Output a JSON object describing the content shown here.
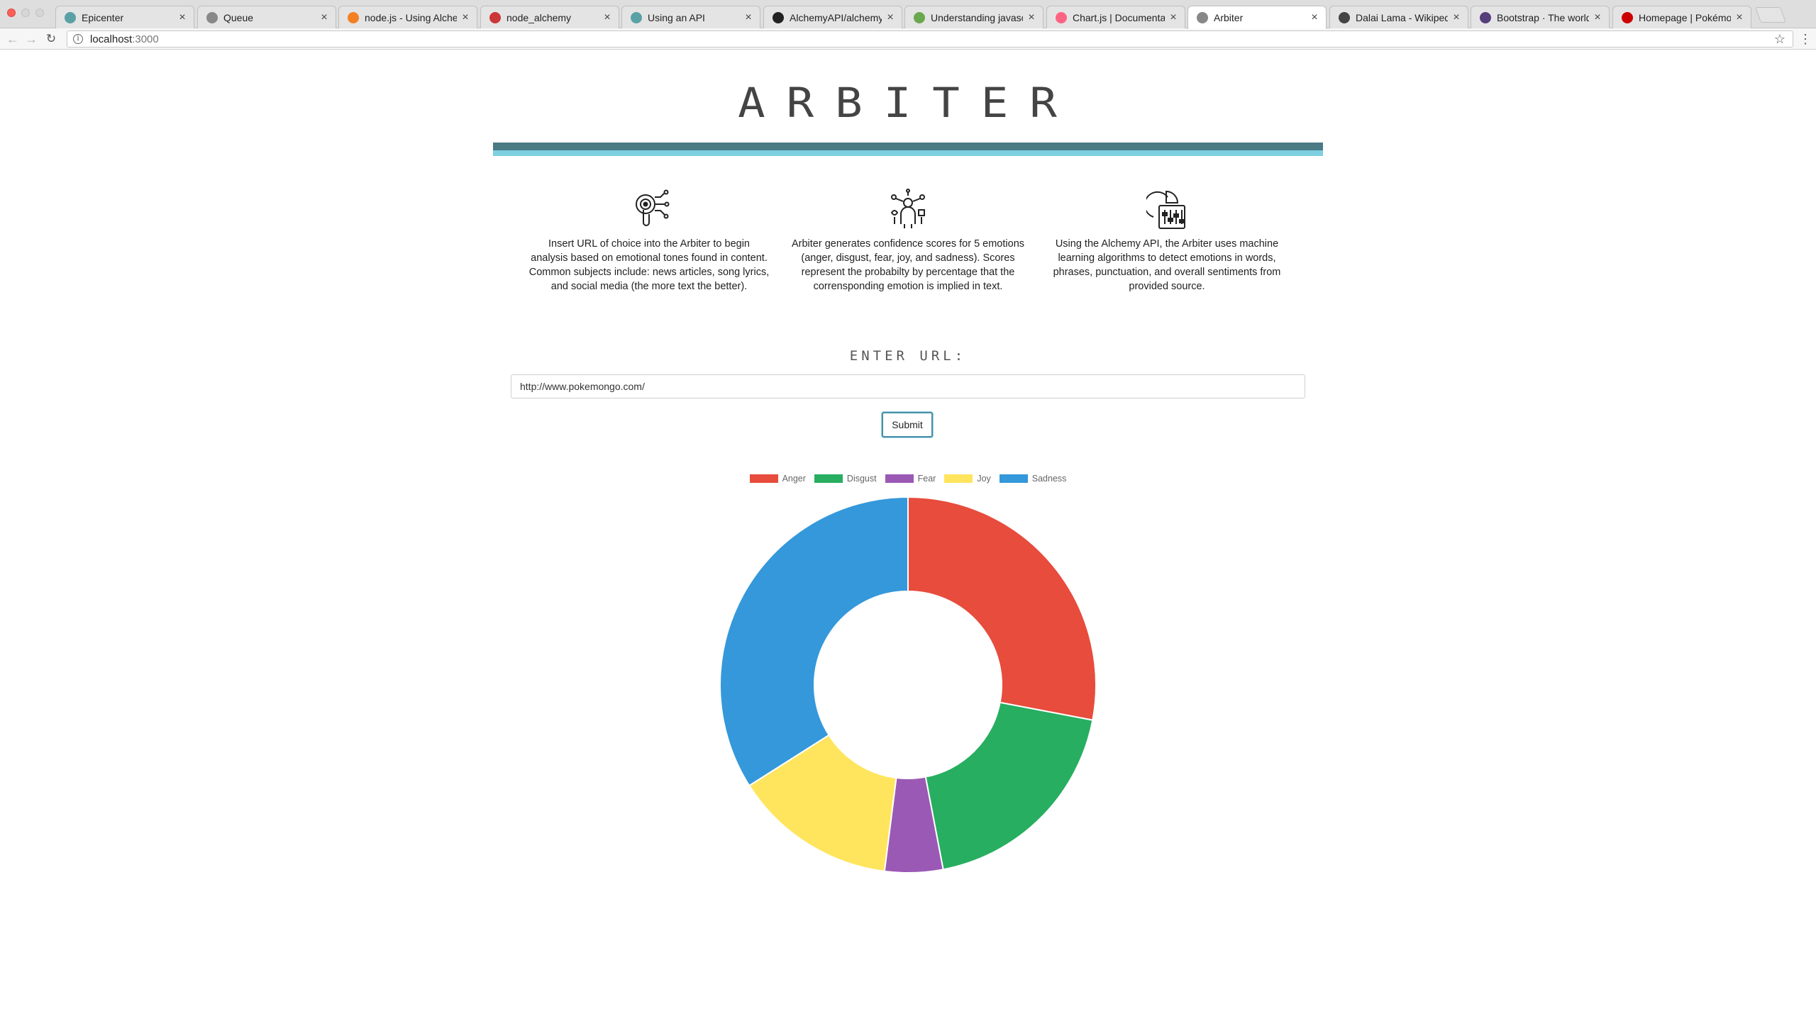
{
  "browser": {
    "tabs": [
      {
        "title": "Epicenter",
        "favicon": "e-circle-icon",
        "color": "#5aa1a6",
        "active": false
      },
      {
        "title": "Queue",
        "favicon": "page-icon",
        "color": "#888888",
        "active": false
      },
      {
        "title": "node.js - Using Alchemy",
        "favicon": "stack-overflow-icon",
        "color": "#f48024",
        "active": false
      },
      {
        "title": "node_alchemy",
        "favicon": "npm-icon",
        "color": "#cb3837",
        "active": false
      },
      {
        "title": "Using an API",
        "favicon": "e-circle-icon",
        "color": "#5aa1a6",
        "active": false
      },
      {
        "title": "AlchemyAPI/alchemyapi_",
        "favicon": "github-icon",
        "color": "#222222",
        "active": false
      },
      {
        "title": "Understanding javascript",
        "favicon": "codementor-icon",
        "color": "#6aa84f",
        "active": false
      },
      {
        "title": "Chart.js | Documentation",
        "favicon": "chartjs-icon",
        "color": "#ff6384",
        "active": false
      },
      {
        "title": "Arbiter",
        "favicon": "page-icon",
        "color": "#888888",
        "active": true
      },
      {
        "title": "Dalai Lama - Wikipedia",
        "favicon": "wikipedia-icon",
        "color": "#444444",
        "active": false
      },
      {
        "title": "Bootstrap · The world's m",
        "favicon": "bootstrap-icon",
        "color": "#563d7c",
        "active": false
      },
      {
        "title": "Homepage | Pokémon Go",
        "favicon": "pokeball-icon",
        "color": "#cc0000",
        "active": false
      }
    ],
    "close_glyph": "×",
    "url_host": "localhost",
    "url_port": ":3000"
  },
  "page": {
    "title": "ARBITER",
    "features": [
      {
        "icon": "touch-analysis-icon",
        "text": "Insert URL of choice into the Arbiter to begin analysis based on emotional tones found in content. Common subjects include: news articles, song lyrics, and social media (the more text the better)."
      },
      {
        "icon": "emotion-person-icon",
        "text": "Arbiter generates confidence scores for 5 emotions (anger, disgust, fear, joy, and sadness). Scores represent the probabilty by percentage that the corrensponding emotion is implied in text."
      },
      {
        "icon": "algorithm-chart-icon",
        "text": "Using the Alchemy API, the Arbiter uses machine learning algorithms to detect emotions in words, phrases, punctuation, and overall sentiments from provided source."
      }
    ],
    "url_label": "ENTER URL:",
    "url_value": "http://www.pokemongo.com/",
    "submit_label": "Submit"
  },
  "colors": {
    "title_bar_dark": "#4a7a84",
    "title_bar_light": "#7ecfdf"
  },
  "chart_data": {
    "type": "pie",
    "title": "",
    "categories": [
      "Anger",
      "Disgust",
      "Fear",
      "Joy",
      "Sadness"
    ],
    "values": [
      0.28,
      0.19,
      0.05,
      0.14,
      0.34
    ],
    "colors": [
      "#e74c3c",
      "#27ae60",
      "#9b59b6",
      "#ffe55e",
      "#3498db"
    ],
    "legend": "top",
    "doughnut": true
  }
}
